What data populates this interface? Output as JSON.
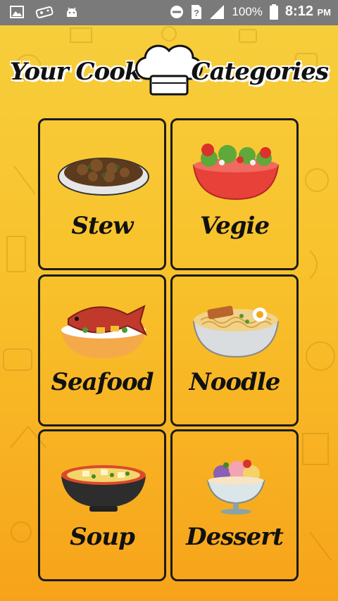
{
  "status_bar": {
    "battery_percent": "100%",
    "time": "8:12",
    "ampm": "PM",
    "icons": [
      "image-icon",
      "game-controller-icon",
      "android-icon",
      "do-not-disturb-icon",
      "sim-question-icon",
      "signal-icon",
      "battery-icon"
    ]
  },
  "header": {
    "title_left": "Your Cook",
    "title_right": "Categories",
    "logo_icon": "chef-hat-icon"
  },
  "categories": [
    {
      "label": "Stew",
      "icon": "stew-plate-icon"
    },
    {
      "label": "Vegie",
      "icon": "salad-bowl-icon"
    },
    {
      "label": "Seafood",
      "icon": "fish-plate-icon"
    },
    {
      "label": "Noodle",
      "icon": "ramen-bowl-icon"
    },
    {
      "label": "Soup",
      "icon": "soup-bowl-icon"
    },
    {
      "label": "Dessert",
      "icon": "dessert-cup-icon"
    }
  ],
  "colors": {
    "status_bar": "#7a7a7a",
    "background_top": "#f7cf3d",
    "background_bottom": "#f7a31a",
    "card_border": "#1b1b1b"
  }
}
